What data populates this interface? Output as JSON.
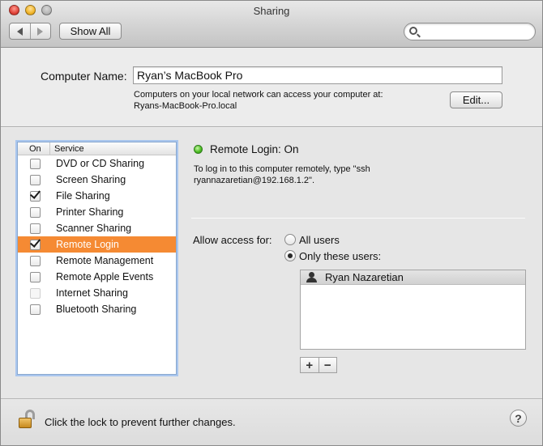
{
  "window": {
    "title": "Sharing"
  },
  "toolbar": {
    "show_all_label": "Show All",
    "search_value": ""
  },
  "computer": {
    "name_label": "Computer Name:",
    "name_value": "Ryan’s MacBook Pro",
    "info_line1": "Computers on your local network can access your computer at:",
    "info_line2": "Ryans-MacBook-Pro.local",
    "edit_label": "Edit..."
  },
  "services": {
    "header_on": "On",
    "header_service": "Service",
    "items": [
      {
        "label": "DVD or CD Sharing",
        "checked": false,
        "selected": false,
        "enabled": true
      },
      {
        "label": "Screen Sharing",
        "checked": false,
        "selected": false,
        "enabled": true
      },
      {
        "label": "File Sharing",
        "checked": true,
        "selected": false,
        "enabled": true
      },
      {
        "label": "Printer Sharing",
        "checked": false,
        "selected": false,
        "enabled": true
      },
      {
        "label": "Scanner Sharing",
        "checked": false,
        "selected": false,
        "enabled": true
      },
      {
        "label": "Remote Login",
        "checked": true,
        "selected": true,
        "enabled": true
      },
      {
        "label": "Remote Management",
        "checked": false,
        "selected": false,
        "enabled": true
      },
      {
        "label": "Remote Apple Events",
        "checked": false,
        "selected": false,
        "enabled": true
      },
      {
        "label": "Internet Sharing",
        "checked": false,
        "selected": false,
        "enabled": false
      },
      {
        "label": "Bluetooth Sharing",
        "checked": false,
        "selected": false,
        "enabled": true
      }
    ]
  },
  "detail": {
    "status_text": "Remote Login: On",
    "status_color": "#4fbf26",
    "login_info_line1": "To log in to this computer remotely, type \"ssh",
    "login_info_line2": "ryannazaretian@192.168.1.2\".",
    "allow_label": "Allow access for:",
    "option_all": "All users",
    "option_only": "Only these users:",
    "selected_option": "only",
    "users": [
      {
        "name": "Ryan Nazaretian",
        "icon": "person-icon"
      }
    ],
    "add_label": "+",
    "remove_label": "−"
  },
  "footer": {
    "lock_text": "Click the lock to prevent further changes.",
    "help_label": "?"
  },
  "colors": {
    "selection": "#f58a33"
  }
}
